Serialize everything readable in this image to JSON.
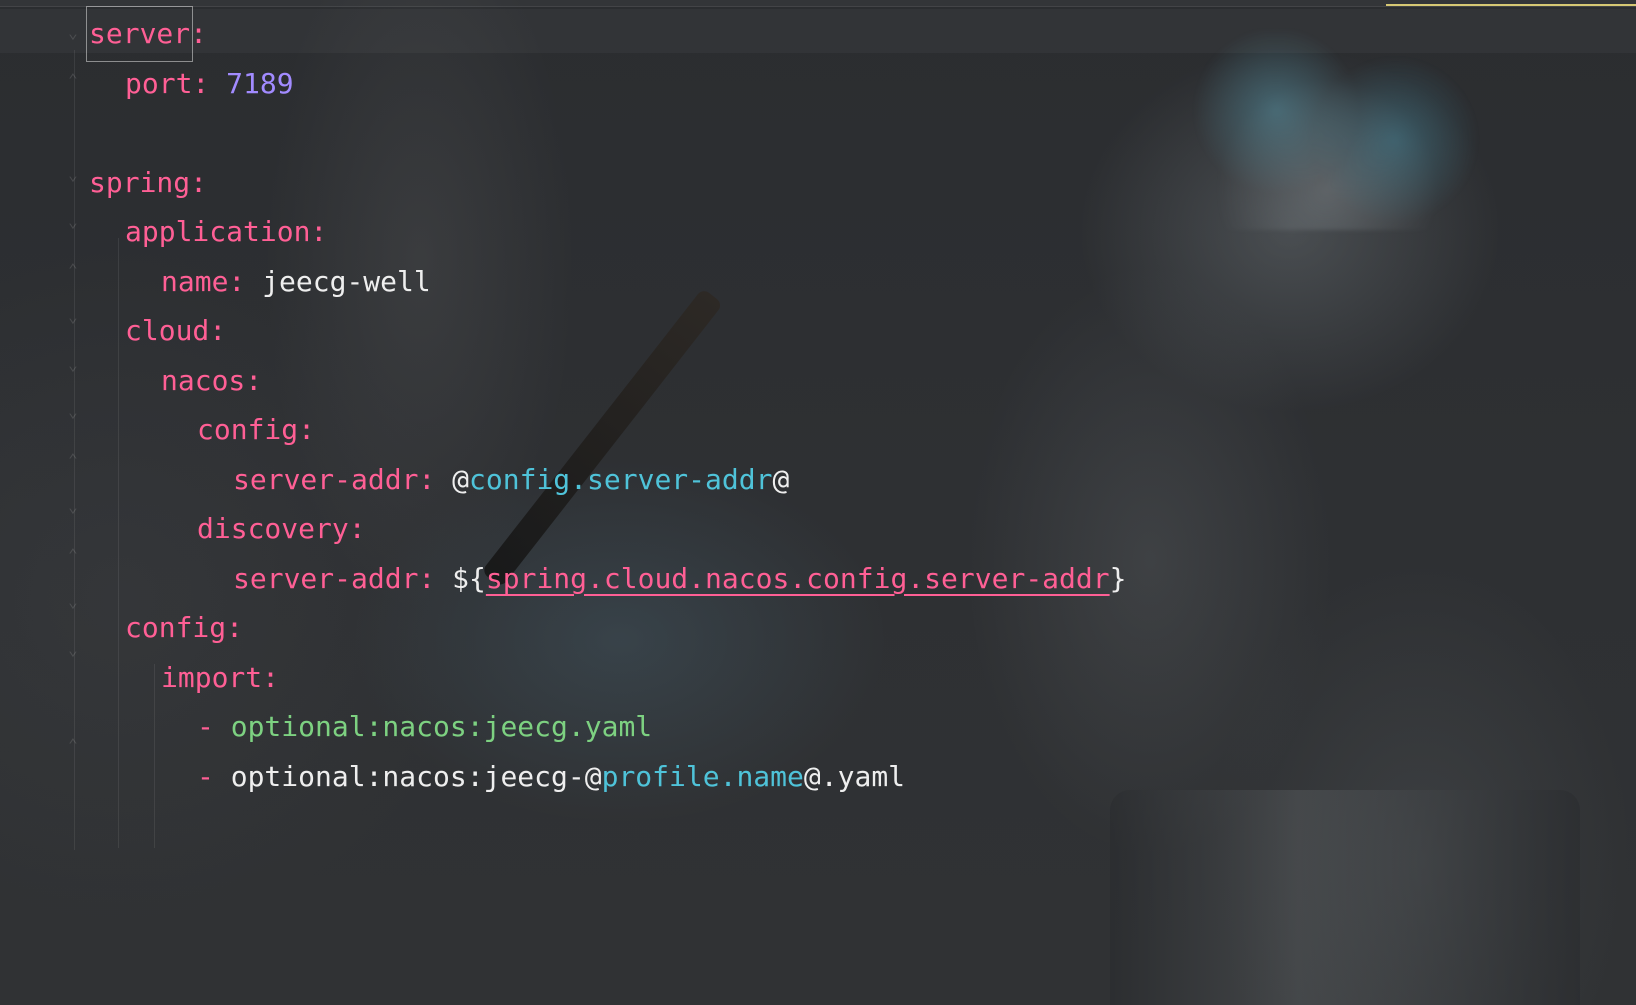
{
  "editor": {
    "lines": [
      {
        "indent": "",
        "tokens": [
          {
            "cls": "key",
            "text": "server"
          },
          {
            "cls": "key",
            "text": ":"
          }
        ]
      },
      {
        "indent": "  ",
        "tokens": [
          {
            "cls": "key",
            "text": "port: "
          },
          {
            "cls": "num",
            "text": "7189"
          }
        ]
      },
      {
        "indent": "",
        "tokens": []
      },
      {
        "indent": "",
        "tokens": [
          {
            "cls": "key",
            "text": "spring:"
          }
        ]
      },
      {
        "indent": "  ",
        "tokens": [
          {
            "cls": "key",
            "text": "application:"
          }
        ]
      },
      {
        "indent": "    ",
        "tokens": [
          {
            "cls": "key",
            "text": "name: "
          },
          {
            "cls": "plain",
            "text": "jeecg-well"
          }
        ]
      },
      {
        "indent": "  ",
        "tokens": [
          {
            "cls": "key",
            "text": "cloud:"
          }
        ]
      },
      {
        "indent": "    ",
        "tokens": [
          {
            "cls": "key",
            "text": "nacos:"
          }
        ]
      },
      {
        "indent": "      ",
        "tokens": [
          {
            "cls": "key",
            "text": "config:"
          }
        ]
      },
      {
        "indent": "        ",
        "tokens": [
          {
            "cls": "key",
            "text": "server-addr: "
          },
          {
            "cls": "plain",
            "text": "@"
          },
          {
            "cls": "ref",
            "text": "config.server-addr"
          },
          {
            "cls": "plain",
            "text": "@"
          }
        ]
      },
      {
        "indent": "      ",
        "tokens": [
          {
            "cls": "key",
            "text": "discovery:"
          }
        ]
      },
      {
        "indent": "        ",
        "tokens": [
          {
            "cls": "key",
            "text": "server-addr: "
          },
          {
            "cls": "plain",
            "text": "${"
          },
          {
            "cls": "underline",
            "text": "spring.cloud.nacos.config.server-addr"
          },
          {
            "cls": "plain",
            "text": "}"
          }
        ]
      },
      {
        "indent": "  ",
        "tokens": [
          {
            "cls": "key",
            "text": "config:"
          }
        ]
      },
      {
        "indent": "    ",
        "tokens": [
          {
            "cls": "key",
            "text": "import:"
          }
        ]
      },
      {
        "indent": "      ",
        "tokens": [
          {
            "cls": "key",
            "text": "- "
          },
          {
            "cls": "green",
            "text": "optional:nacos:jeecg.yaml"
          }
        ]
      },
      {
        "indent": "      ",
        "tokens": [
          {
            "cls": "key",
            "text": "- "
          },
          {
            "cls": "plain",
            "text": "optional:nacos:jeecg-@"
          },
          {
            "cls": "ref",
            "text": "profile.name"
          },
          {
            "cls": "plain",
            "text": "@.yaml"
          }
        ]
      }
    ]
  },
  "colors": {
    "key": "#ff5f95",
    "number": "#a28bff",
    "plain": "#eeeeee",
    "reference": "#4fc3d9",
    "string": "#7dd181",
    "scroll_marker": "#d6c874"
  },
  "fold_icons": {
    "open": "fold-open-icon",
    "close": "fold-close-icon"
  }
}
